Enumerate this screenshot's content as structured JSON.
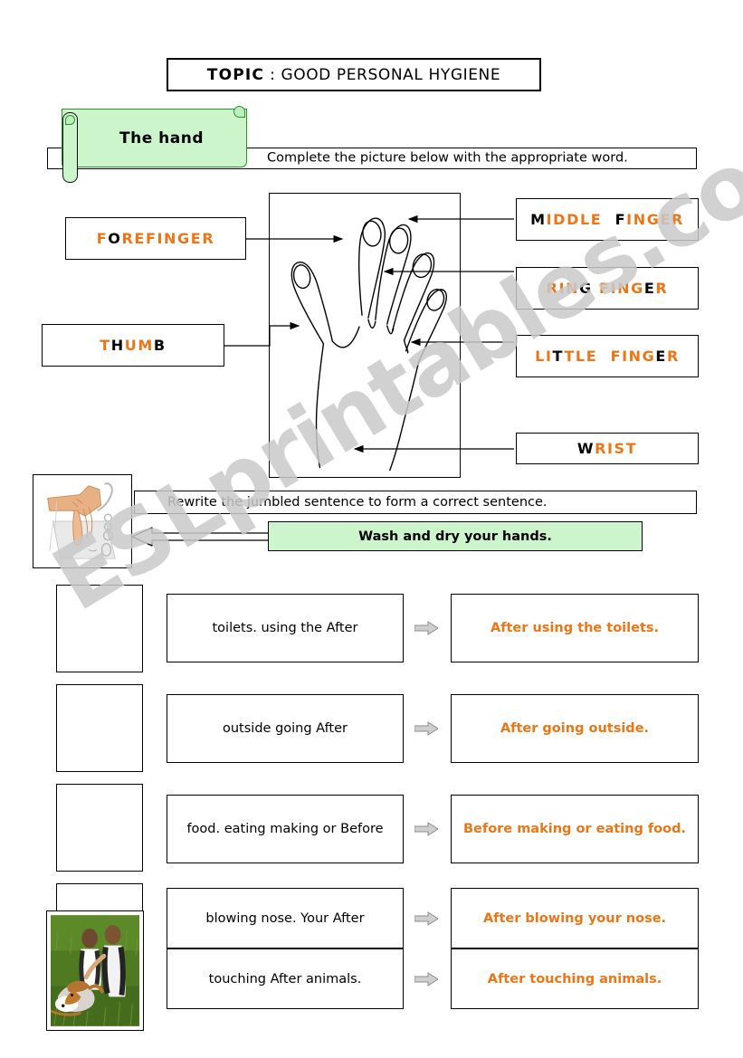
{
  "topic": {
    "label": "TOPIC",
    "separator": " : ",
    "subject": "GOOD PERSONAL HYGIENE"
  },
  "section_hand": {
    "banner_label": "The hand",
    "instruction": "Complete the picture below with the appropriate word.",
    "labels": [
      {
        "name": "forefinger",
        "text": "FOREFINGER",
        "black_letter_indexes": [
          1
        ]
      },
      {
        "name": "thumb",
        "text": "THUMB",
        "black_letter_indexes": [
          1,
          4
        ]
      },
      {
        "name": "middle-finger",
        "text": "MIDDLE  FINGER",
        "black_letter_indexes": [
          0,
          8
        ]
      },
      {
        "name": "ring-finger",
        "text": "RING FINGER",
        "black_letter_indexes": [
          3,
          9
        ]
      },
      {
        "name": "little-finger",
        "text": "LITTLE  FINGER",
        "black_letter_indexes": [
          2,
          12
        ]
      },
      {
        "name": "wrist",
        "text": "WRIST",
        "black_letter_indexes": [
          0
        ]
      }
    ],
    "colors": {
      "orange": "#e8761a",
      "black": "#000000",
      "green": "#ccf5cc"
    }
  },
  "section_rewrite": {
    "instruction": "Rewrite the jumbled sentence to form a correct sentence.",
    "example_sentence": "Wash and dry your hands.",
    "rows": [
      {
        "jumbled": "toilets. using the After",
        "answer": "After using the toilets."
      },
      {
        "jumbled": "outside going After",
        "answer": "After going outside."
      },
      {
        "jumbled": "food. eating making or Before",
        "answer": "Before making or eating food."
      },
      {
        "jumbled": "blowing  nose. Your After",
        "answer": "After blowing your nose."
      },
      {
        "jumbled": "touching After animals.",
        "answer": "After touching animals."
      }
    ]
  },
  "watermark": {
    "text": "ESLprintables.com",
    "color": "#c9c9c9"
  },
  "icons": {
    "hand_diagram": "hand-outline-icon",
    "wash_hands": "washing-hands-icon",
    "dog_photo": "people-with-dog-photo",
    "arrow": "right-arrow-icon",
    "block_arrow": "left-block-arrow-icon"
  }
}
